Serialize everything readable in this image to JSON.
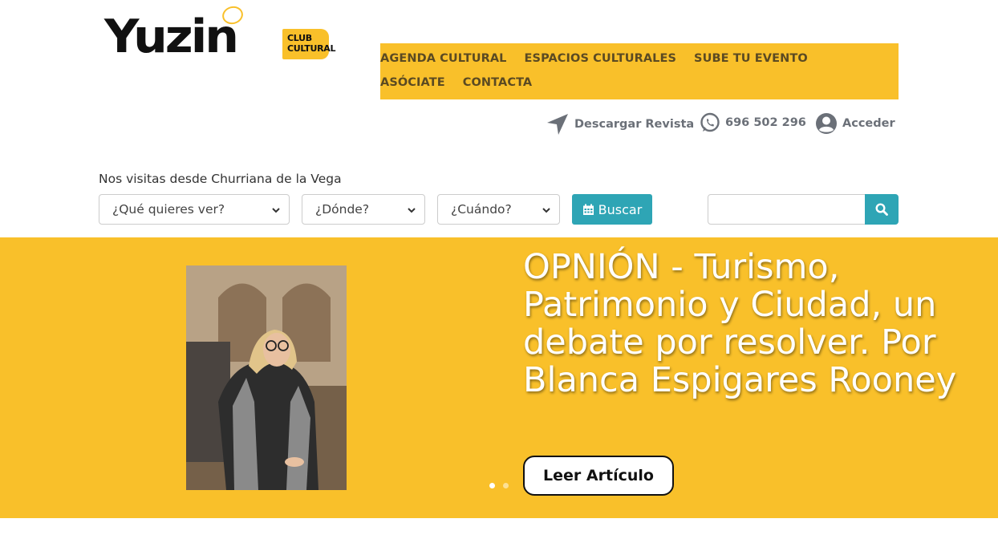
{
  "logo": {
    "word": "Yuzin",
    "badge_line1": "CLUB",
    "badge_line2": "CULTURAL",
    "accent_color": "#f9c02a"
  },
  "nav": {
    "items": [
      {
        "label": "AGENDA CULTURAL"
      },
      {
        "label": "ESPACIOS CULTURALES"
      },
      {
        "label": "SUBE TU EVENTO"
      },
      {
        "label": "ASÓCIATE"
      },
      {
        "label": "CONTACTA"
      }
    ],
    "background": "#f9c02a"
  },
  "utility": {
    "download": {
      "label": "Descargar Revista",
      "icon": "location-arrow-icon"
    },
    "phone": {
      "label": "696 502 296",
      "icon": "whatsapp-icon"
    },
    "login": {
      "label": "Acceder",
      "icon": "user-circle-icon"
    }
  },
  "visit": {
    "text": "Nos visitas desde Churriana de la Vega"
  },
  "filters": {
    "what": {
      "selected": "¿Qué quieres ver?"
    },
    "where": {
      "selected": "¿Dónde?"
    },
    "when": {
      "selected": "¿Cuándo?"
    },
    "search_button": "Buscar",
    "search_button_icon": "calendar-icon",
    "search_input_value": "",
    "search_submit_icon": "search-icon",
    "button_color": "#2ea5b5"
  },
  "hero": {
    "title": "OPNIÓN - Turismo, Patrimonio y Ciudad, un debate por resolver. Por Blanca Espigares Rooney",
    "button": "Leer Artículo",
    "slide_count": 2,
    "active_slide": 1,
    "background": "#f9c02a"
  }
}
